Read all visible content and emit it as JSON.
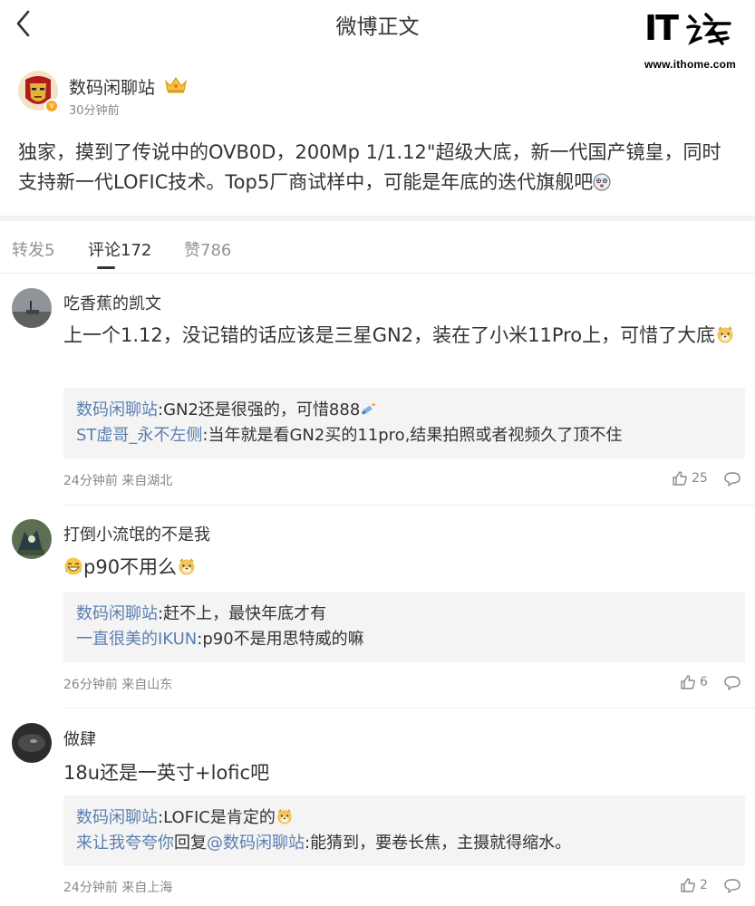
{
  "navbar": {
    "title": "微博正文",
    "back_icon": "chevron-left-icon"
  },
  "watermark": {
    "logo_text": "IT",
    "logo_suffix": "之家",
    "url": "www.ithome.com"
  },
  "post": {
    "author": "数码闲聊站",
    "time": "30分钟前",
    "text": "独家，摸到了传说中的OVB0D，200Mp 1/1.12\"超级大底，新一代国产镜皇，同时支持新一代LOFIC技术。Top5厂商试样中，可能是年底的迭代旗舰吧"
  },
  "tabs": [
    {
      "label": "转发5"
    },
    {
      "label": "评论172"
    },
    {
      "label": "赞786"
    }
  ],
  "comments": [
    {
      "user": "吃香蕉的凯文",
      "text": "上一个1.12，没记错的话应该是三星GN2，装在了小米11Pro上，可惜了大底",
      "replies": [
        {
          "user": "数码闲聊站",
          "text": ":GN2还是很强的，可惜888"
        },
        {
          "user": "ST虚哥_永不左侧",
          "text": ":当年就是看GN2买的11pro,结果拍照或者视频久了顶不住"
        }
      ],
      "meta": "24分钟前 来自湖北",
      "likes": "25"
    },
    {
      "user": "打倒小流氓的不是我",
      "text": "p90不用么",
      "replies": [
        {
          "user": "数码闲聊站",
          "text": ":赶不上，最快年底才有"
        },
        {
          "user": "一直很美的IKUN",
          "text": ":p90不是用思特威的嘛"
        }
      ],
      "meta": "26分钟前 来自山东",
      "likes": "6"
    },
    {
      "user": "做肆",
      "text": "18u还是一英寸+lofic吧",
      "replies": [
        {
          "user": "数码闲聊站",
          "text": ":LOFIC是肯定的"
        },
        {
          "user": "来让我夸夸你",
          "mid": "回复",
          "mention": "@数码闲聊站",
          "text": ":能猜到，要卷长焦，主摄就得缩水。"
        }
      ],
      "meta": "24分钟前 来自上海",
      "likes": "2"
    }
  ],
  "colors": {
    "link": "#5b7faf",
    "reply_bg": "#f4f4f4",
    "meta": "#888888",
    "verified": "#f6a623"
  }
}
